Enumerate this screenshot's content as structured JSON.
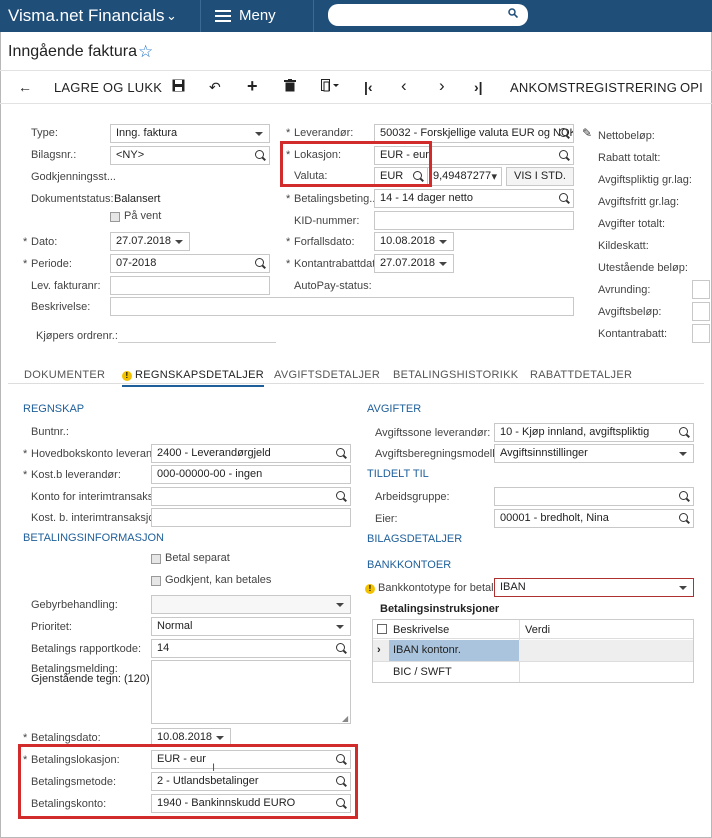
{
  "app": {
    "title": "Visma.net Financials",
    "menu_label": "Meny"
  },
  "page": {
    "title": "Inngående faktura"
  },
  "toolbar": {
    "save_close": "LAGRE OG LUKK",
    "ankomst": "ANKOMSTREGISTRERING",
    "overflow": "OPI"
  },
  "form": {
    "type_label": "Type:",
    "type_value": "Inng. faktura",
    "bilagsnr_label": "Bilagsnr.:",
    "bilagsnr_value": "<NY>",
    "godkj_label": "Godkjenningsst...",
    "dokstatus_label": "Dokumentstatus:",
    "dokstatus_value": "Balansert",
    "paavent_label": "På vent",
    "dato_label": "Dato:",
    "dato_value": "27.07.2018",
    "periode_label": "Periode:",
    "periode_value": "07-2018",
    "levfaktura_label": "Lev. fakturanr:",
    "beskrivelse_label": "Beskrivelse:",
    "kjopers_label": "Kjøpers ordrenr.:",
    "leverandor_label": "Leverandør:",
    "leverandor_value": "50032 - Forskjellige valuta EUR og NOK",
    "lokasjon_label": "Lokasjon:",
    "lokasjon_value": "EUR - eur",
    "valuta_label": "Valuta:",
    "valuta_value": "EUR",
    "valuta_rate": "9,49487277",
    "vis_std": "VIS I STD.",
    "betbeting_label": "Betalingsbeting...",
    "betbeting_value": "14 - 14 dager netto",
    "kid_label": "KID-nummer:",
    "forfall_label": "Forfallsdato:",
    "forfall_value": "10.08.2018",
    "kontantrabatt_label": "Kontantrabattdato:",
    "kontantrabatt_value": "27.07.2018",
    "autopay_label": "AutoPay-status:"
  },
  "summary": [
    "Nettobeløp:",
    "Rabatt totalt:",
    "Avgiftspliktig gr.lag:",
    "Avgiftsfritt gr.lag:",
    "Avgifter totalt:",
    "Kildeskatt:",
    "Utestående beløp:",
    "Avrunding:",
    "Avgiftsbeløp:",
    "Kontantrabatt:"
  ],
  "tabs": [
    "DOKUMENTER",
    "REGNSKAPSDETALJER",
    "AVGIFTSDETALJER",
    "BETALINGSHISTORIKK",
    "RABATTDETALJER"
  ],
  "regnskap": {
    "section": "REGNSKAP",
    "buntnr": "Buntnr.:",
    "hovedbok_label": "Hovedbokskonto leveran...",
    "hovedbok_value": "2400 - Leverandørgjeld",
    "kostb_label": "Kost.b leverandør:",
    "kostb_value": "000-00000-00 - ingen",
    "interim1_label": "Konto for interimtransaksj...",
    "interim2_label": "Kost. b. interimtransaksjo..."
  },
  "betinfo": {
    "section": "BETALINGSINFORMASJON",
    "betal_separat": "Betal separat",
    "godkjent": "Godkjent, kan betales",
    "gebyr_label": "Gebyrbehandling:",
    "prioritet_label": "Prioritet:",
    "prioritet_value": "Normal",
    "rapportkode_label": "Betalings rapportkode:",
    "rapportkode_value": "14",
    "melding_label": "Betalingsmelding:",
    "gjenstaende": "Gjenstående tegn: (120)",
    "betdato_label": "Betalingsdato:",
    "betdato_value": "10.08.2018",
    "betlok_label": "Betalingslokasjon:",
    "betlok_value": "EUR - eur",
    "betmetode_label": "Betalingsmetode:",
    "betmetode_value": "2 - Utlandsbetalinger",
    "betkonto_label": "Betalingskonto:",
    "betkonto_value": "1940 - Bankinnskudd EURO"
  },
  "avgifter": {
    "section": "AVGIFTER",
    "sone_label": "Avgiftssone leverandør:",
    "sone_value": "10 - Kjøp innland, avgiftspliktig",
    "modell_label": "Avgiftsberegningsmodell:",
    "modell_value": "Avgiftsinnstillinger"
  },
  "tildelt": {
    "section": "TILDELT TIL",
    "arbeidsgruppe_label": "Arbeidsgruppe:",
    "eier_label": "Eier:",
    "eier_value": "00001 - bredholt, Nina"
  },
  "bilagsdetaljer": "BILAGSDETALJER",
  "bankkontoer": {
    "section": "BANKKONTOER",
    "type_label": "Bankkontotype for betaling:",
    "type_value": "IBAN",
    "instr_title": "Betalingsinstruksjoner",
    "col_beskrivelse": "Beskrivelse",
    "col_verdi": "Verdi",
    "rows": [
      "IBAN kontonr.",
      "BIC / SWFT"
    ]
  }
}
